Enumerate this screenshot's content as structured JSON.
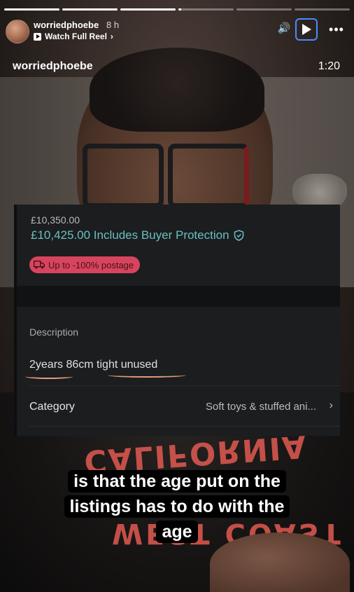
{
  "story": {
    "progress_segments": [
      1,
      1,
      1,
      0.05,
      0,
      0
    ],
    "username": "worriedphoebe",
    "age": "8 h",
    "watch_label": "Watch Full Reel",
    "overlay_username": "worriedphoebe",
    "duration": "1:20"
  },
  "icons": {
    "volume": "speaker-icon",
    "play": "play-icon",
    "more": "more-icon",
    "chevron": "chevron-right-icon"
  },
  "listing": {
    "price": "£10,350.00",
    "price_total": "£10,425.00 Includes Buyer Protection",
    "postage_badge": "Up to -100% postage",
    "description_heading": "Description",
    "description_text": "2years  86cm tight unused",
    "category_label": "Category",
    "category_value": "Soft toys & stuffed ani..."
  },
  "captions": {
    "line1": "is that the age put on the",
    "line2": "listings has to do with the",
    "line3": "age"
  },
  "colors": {
    "accent_blue": "#4a8cff",
    "price_teal": "#6bbfc0",
    "badge_pink": "#d6455d"
  }
}
